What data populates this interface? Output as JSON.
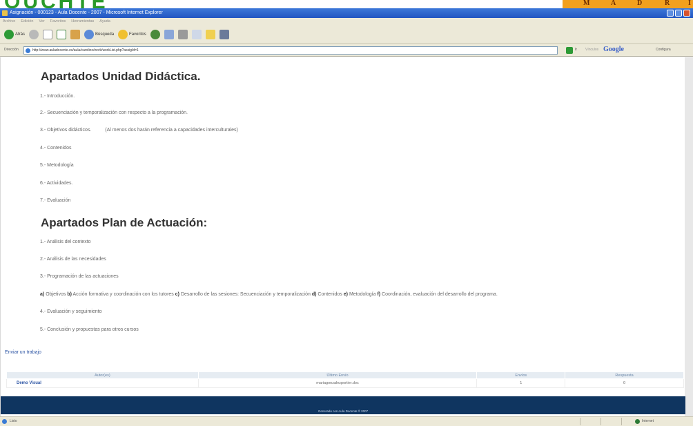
{
  "banner": {
    "logo_text": "OUCHTE",
    "madrid_letters": [
      "M",
      "A",
      "D",
      "R",
      "I"
    ]
  },
  "window": {
    "title": "Asignación - 000123 - Aula Docente - 2007 - Microsoft Internet Explorer"
  },
  "menu": [
    "Archivo",
    "Edición",
    "Ver",
    "Favoritos",
    "Herramientas",
    "Ayuda"
  ],
  "toolbar": {
    "back_label": "Atrás",
    "search_label": "Búsqueda",
    "favorites_label": "Favoritos"
  },
  "address": {
    "label": "Dirección",
    "url": "http://www.auladocente.es/aula/caroline/work/workList.php?assigId=1",
    "go_label": "Ir",
    "links_label": "Vínculos",
    "google": "Google",
    "config_label": "Configura"
  },
  "sections": {
    "unidad": {
      "title": "Apartados Unidad Didáctica.",
      "items": [
        "1.- Introducción.",
        "2.- Secuenciación y temporalización con respecto a la programación.",
        "3.- Objetivos didácticos.",
        "4.- Contenidos",
        "5.- Metodología",
        "6.- Actividades.",
        "7.- Evaluación"
      ],
      "item3_note": "(Al menos dos harán referencia a capacidades interculturales)"
    },
    "plan": {
      "title": "Apartados Plan de Actuación:",
      "items": [
        "1.- Análisis del contexto",
        "2.- Análisis de las necesidades",
        "3.- Programación de las actuaciones",
        "4.- Evaluación y seguimiento",
        "5.- Conclusión y propuestas para otros cursos"
      ],
      "subitems": [
        {
          "letter": "a)",
          "text": "Objetivos"
        },
        {
          "letter": "b)",
          "text": "Acción formativa y coordinación con los tutores"
        },
        {
          "letter": "c)",
          "text": "Desarrollo de las sesiones: Secuenciación y temporalización"
        },
        {
          "letter": "d)",
          "text": "Contenidos"
        },
        {
          "letter": "e)",
          "text": "Metodología"
        },
        {
          "letter": "f)",
          "text": "Coordinación, evaluación del desarrollo del programa."
        }
      ]
    }
  },
  "enviar_link": "Enviar un trabajo",
  "table": {
    "headers": [
      "Autor(es)",
      "Último Envío",
      "Envíos",
      "Respuesta"
    ],
    "rows": [
      {
        "author": "Demo Visual",
        "last": "mariagonzalezportier.doc",
        "count": "1",
        "reply": "0"
      }
    ]
  },
  "footer_text": "Generado con Aula Docente ® 2007",
  "status": {
    "left": "Listo",
    "right": "Internet"
  }
}
